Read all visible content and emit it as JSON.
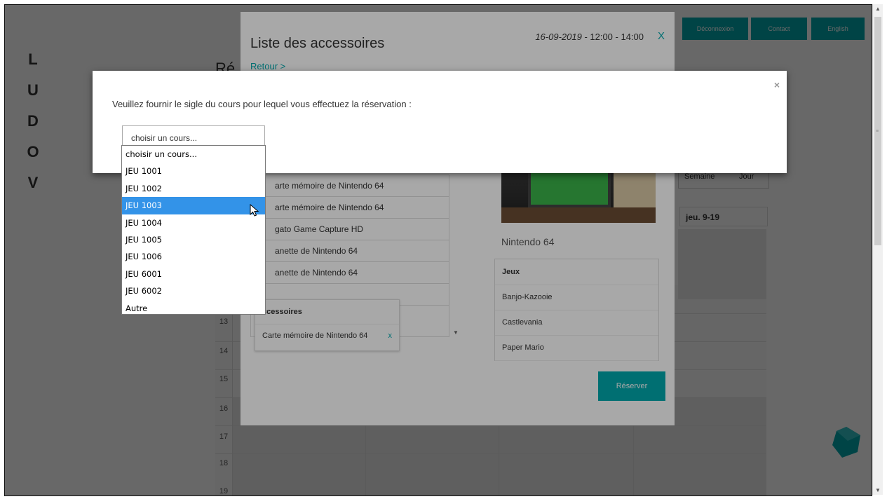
{
  "logo_letters": [
    "L",
    "U",
    "D",
    "O",
    "V"
  ],
  "top_buttons": [
    "Déconnexion",
    "Contact",
    "English"
  ],
  "background_title": "Ré",
  "calendar": {
    "hours": [
      "13",
      "14",
      "15",
      "16",
      "17",
      "18",
      "19"
    ],
    "day_label": "jeu. 9-19",
    "week_tabs": [
      "Semaine",
      "Jour"
    ]
  },
  "accessories_modal": {
    "title": "Liste des accessoires",
    "back_link": "Retour >",
    "date_prefix": "16-09-2019",
    "time_range": " - 12:00 - 14:00",
    "close_label": "X",
    "items": [
      "arte mémoire de Nintendo 64",
      "arte mémoire de Nintendo 64",
      "gato Game Capture HD",
      "anette de Nintendo 64",
      "anette de Nintendo 64",
      ""
    ],
    "selected_box": {
      "header": "ccessoires",
      "item": "Carte mémoire de Nintendo 64",
      "remove_label": "x"
    },
    "console_name": "Nintendo 64",
    "games_header": "Jeux",
    "games": [
      "Banjo-Kazooie",
      "Castlevania",
      "Paper Mario"
    ],
    "reserve_label": "Réserver"
  },
  "course_modal": {
    "prompt": "Veuillez fournir le sigle du cours pour lequel vous effectuez la réservation :",
    "close_label": "×",
    "select_value": "choisir un cours..."
  },
  "dropdown": {
    "selected_index": 3,
    "options": [
      "choisir un cours...",
      "JEU 1001",
      "JEU 1002",
      "JEU 1003",
      "JEU 1004",
      "JEU 1005",
      "JEU 1006",
      "JEU 6001",
      "JEU 6002",
      "Autre"
    ]
  },
  "colors": {
    "accent": "#00a9ad",
    "highlight": "#3393e8"
  }
}
